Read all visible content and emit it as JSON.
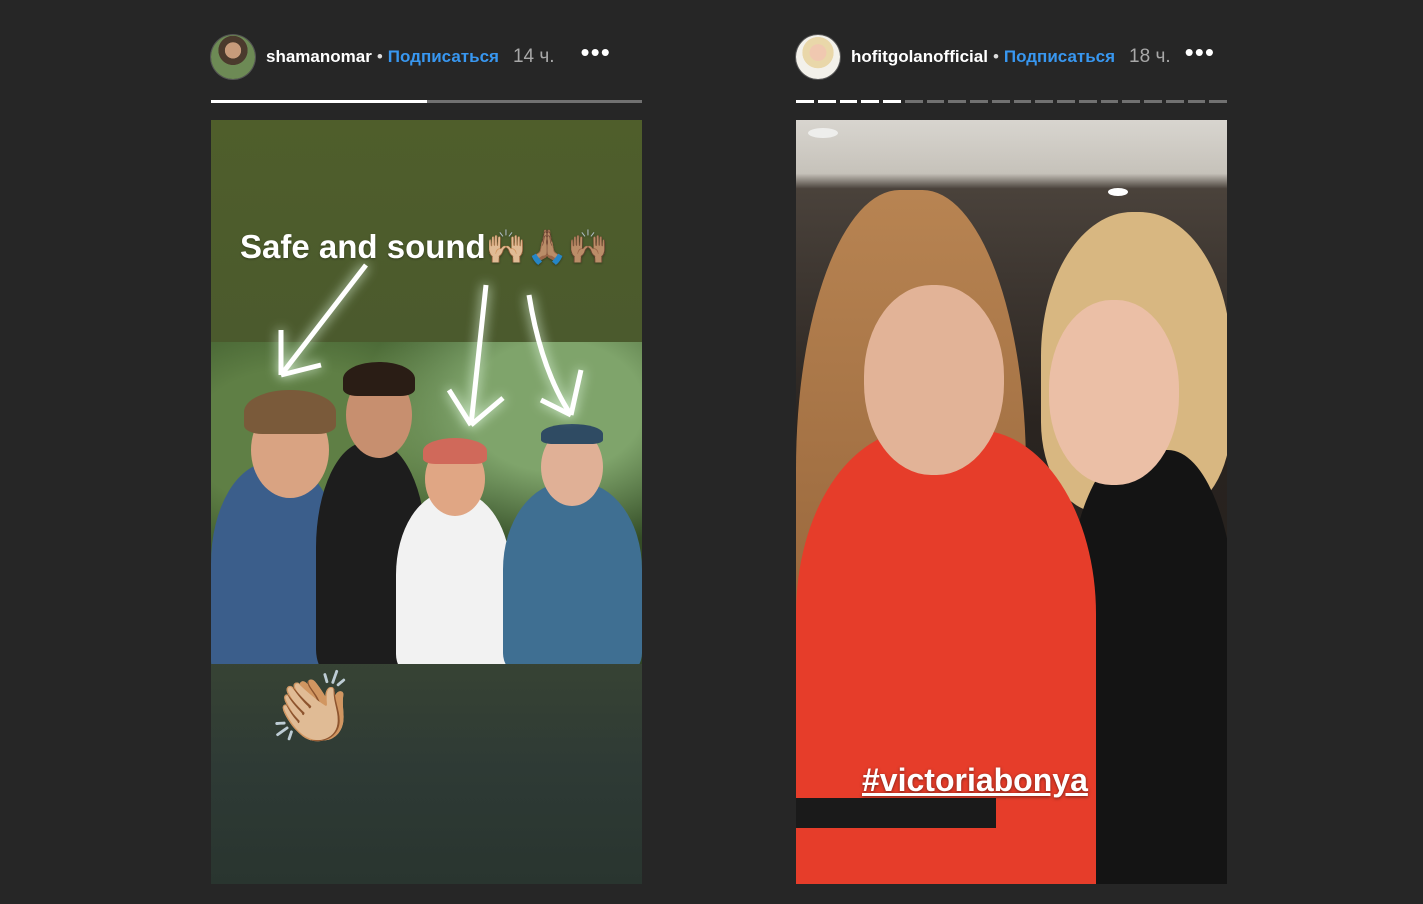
{
  "stories": [
    {
      "username": "shamanomar",
      "separator": "•",
      "follow_label": "Подписаться",
      "time": "14 ч.",
      "more_label": "•••",
      "progress": [
        0.5
      ],
      "caption": "Safe and sound🙌🏼🙏🏽🙌🏽",
      "emoji": "👏🏼",
      "avatar_icon": "user-avatar"
    },
    {
      "username": "hofitgolanofficial",
      "separator": "•",
      "follow_label": "Подписаться",
      "time": "18 ч.",
      "more_label": "•••",
      "progress": [
        1,
        1,
        1,
        1,
        1,
        0,
        0,
        0,
        0,
        0,
        0,
        0,
        0,
        0,
        0,
        0,
        0,
        0,
        0,
        0
      ],
      "hashtag": "#victoriabonya",
      "avatar_icon": "user-avatar"
    }
  ],
  "colors": {
    "background": "#262626",
    "follow": "#3897f0",
    "time": "#a8a8a8"
  }
}
